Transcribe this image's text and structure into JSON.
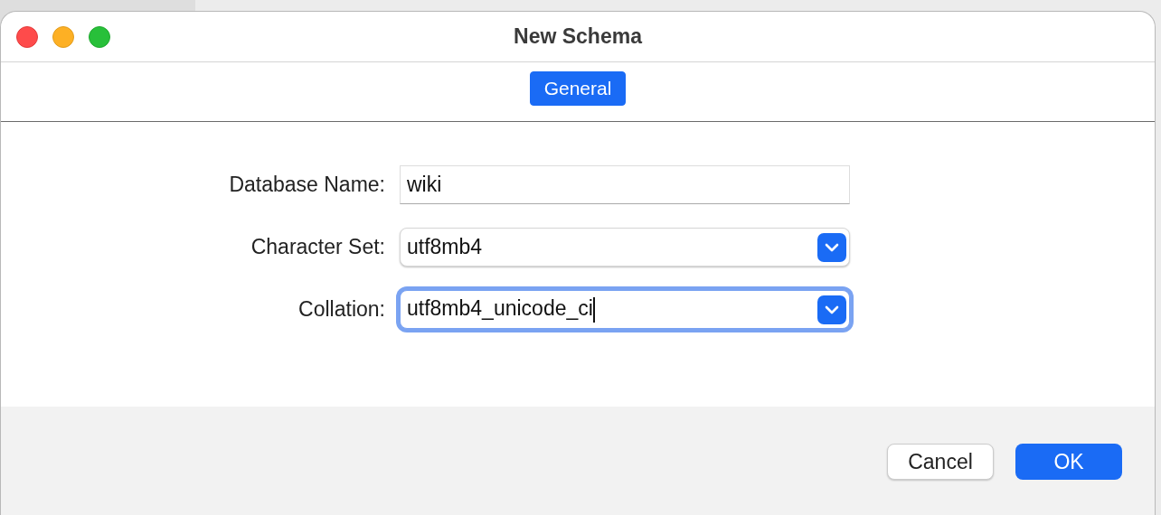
{
  "window": {
    "title": "New Schema"
  },
  "tabs": [
    {
      "label": "General",
      "selected": true
    }
  ],
  "fields": [
    {
      "label": "Database Name:",
      "kind": "text",
      "value": "wiki",
      "focused": false
    },
    {
      "label": "Character Set:",
      "kind": "select",
      "value": "utf8mb4",
      "focused": false
    },
    {
      "label": "Collation:",
      "kind": "select",
      "value": "utf8mb4_unicode_ci",
      "focused": true
    }
  ],
  "buttons": [
    {
      "label": "Cancel",
      "kind": "default"
    },
    {
      "label": "OK",
      "kind": "primary"
    }
  ]
}
